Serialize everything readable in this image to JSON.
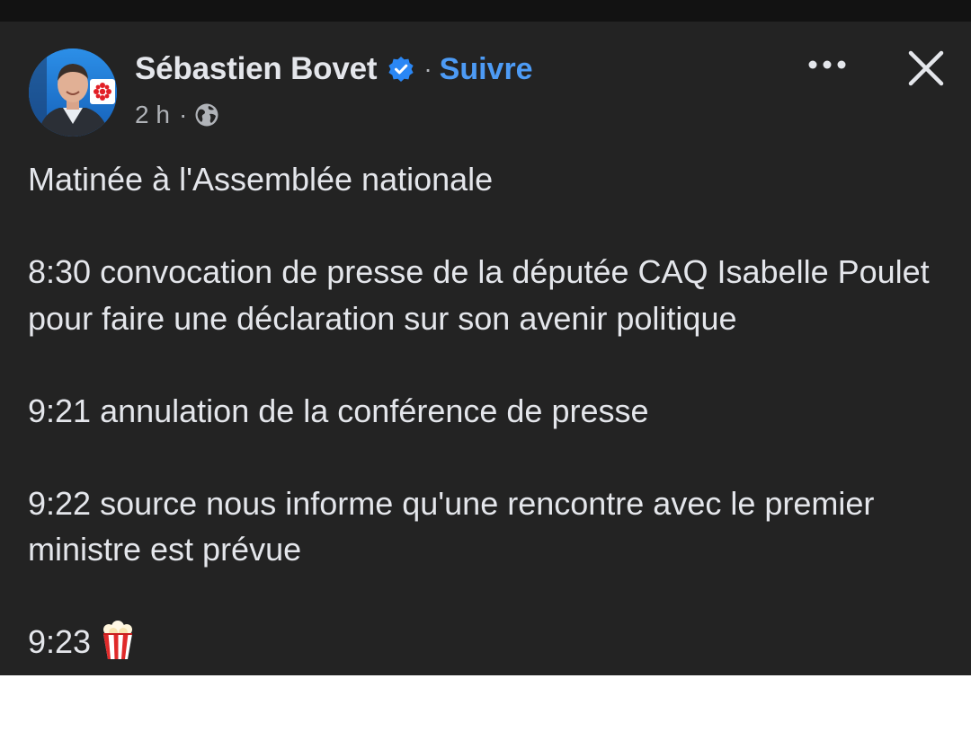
{
  "post": {
    "author": {
      "name": "Sébastien Bovet",
      "verified_icon": "verified-badge-icon",
      "follow_label": "Suivre",
      "separator": "·"
    },
    "meta": {
      "time": "2 h",
      "separator": "·",
      "audience_icon": "globe-icon"
    },
    "actions": {
      "more_icon": "more-options-icon",
      "close_icon": "close-icon"
    },
    "paragraphs": [
      "Matinée à l'Assemblée nationale",
      "8:30 convocation de presse de la députée CAQ Isabelle Poulet pour faire une déclaration sur son avenir politique",
      "9:21 annulation de la conférence de presse",
      "9:22 source nous informe qu'une rencontre avec le premier ministre est prévue",
      "9:23"
    ],
    "emoji": "popcorn"
  },
  "colors": {
    "background": "#232323",
    "text": "#e4e6eb",
    "secondary_text": "#b0b3b8",
    "link_blue": "#4d9bf5"
  }
}
